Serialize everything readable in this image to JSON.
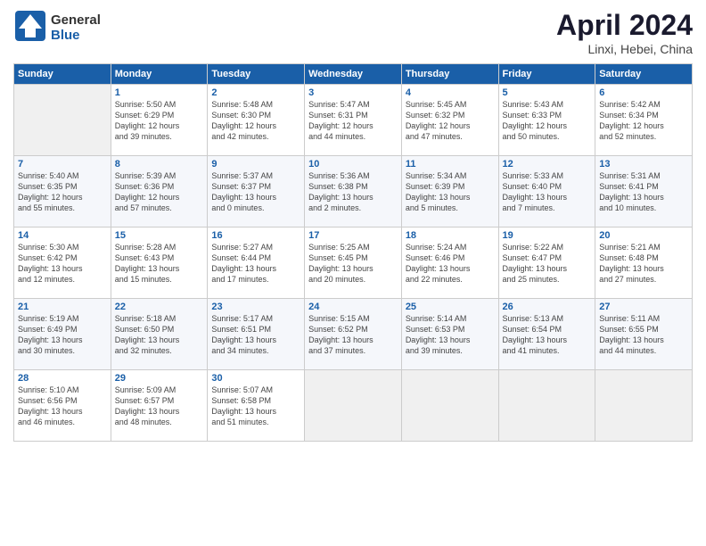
{
  "logo": {
    "general": "General",
    "blue": "Blue"
  },
  "title": "April 2024",
  "subtitle": "Linxi, Hebei, China",
  "days_header": [
    "Sunday",
    "Monday",
    "Tuesday",
    "Wednesday",
    "Thursday",
    "Friday",
    "Saturday"
  ],
  "weeks": [
    [
      {
        "num": "",
        "info": ""
      },
      {
        "num": "1",
        "info": "Sunrise: 5:50 AM\nSunset: 6:29 PM\nDaylight: 12 hours\nand 39 minutes."
      },
      {
        "num": "2",
        "info": "Sunrise: 5:48 AM\nSunset: 6:30 PM\nDaylight: 12 hours\nand 42 minutes."
      },
      {
        "num": "3",
        "info": "Sunrise: 5:47 AM\nSunset: 6:31 PM\nDaylight: 12 hours\nand 44 minutes."
      },
      {
        "num": "4",
        "info": "Sunrise: 5:45 AM\nSunset: 6:32 PM\nDaylight: 12 hours\nand 47 minutes."
      },
      {
        "num": "5",
        "info": "Sunrise: 5:43 AM\nSunset: 6:33 PM\nDaylight: 12 hours\nand 50 minutes."
      },
      {
        "num": "6",
        "info": "Sunrise: 5:42 AM\nSunset: 6:34 PM\nDaylight: 12 hours\nand 52 minutes."
      }
    ],
    [
      {
        "num": "7",
        "info": "Sunrise: 5:40 AM\nSunset: 6:35 PM\nDaylight: 12 hours\nand 55 minutes."
      },
      {
        "num": "8",
        "info": "Sunrise: 5:39 AM\nSunset: 6:36 PM\nDaylight: 12 hours\nand 57 minutes."
      },
      {
        "num": "9",
        "info": "Sunrise: 5:37 AM\nSunset: 6:37 PM\nDaylight: 13 hours\nand 0 minutes."
      },
      {
        "num": "10",
        "info": "Sunrise: 5:36 AM\nSunset: 6:38 PM\nDaylight: 13 hours\nand 2 minutes."
      },
      {
        "num": "11",
        "info": "Sunrise: 5:34 AM\nSunset: 6:39 PM\nDaylight: 13 hours\nand 5 minutes."
      },
      {
        "num": "12",
        "info": "Sunrise: 5:33 AM\nSunset: 6:40 PM\nDaylight: 13 hours\nand 7 minutes."
      },
      {
        "num": "13",
        "info": "Sunrise: 5:31 AM\nSunset: 6:41 PM\nDaylight: 13 hours\nand 10 minutes."
      }
    ],
    [
      {
        "num": "14",
        "info": "Sunrise: 5:30 AM\nSunset: 6:42 PM\nDaylight: 13 hours\nand 12 minutes."
      },
      {
        "num": "15",
        "info": "Sunrise: 5:28 AM\nSunset: 6:43 PM\nDaylight: 13 hours\nand 15 minutes."
      },
      {
        "num": "16",
        "info": "Sunrise: 5:27 AM\nSunset: 6:44 PM\nDaylight: 13 hours\nand 17 minutes."
      },
      {
        "num": "17",
        "info": "Sunrise: 5:25 AM\nSunset: 6:45 PM\nDaylight: 13 hours\nand 20 minutes."
      },
      {
        "num": "18",
        "info": "Sunrise: 5:24 AM\nSunset: 6:46 PM\nDaylight: 13 hours\nand 22 minutes."
      },
      {
        "num": "19",
        "info": "Sunrise: 5:22 AM\nSunset: 6:47 PM\nDaylight: 13 hours\nand 25 minutes."
      },
      {
        "num": "20",
        "info": "Sunrise: 5:21 AM\nSunset: 6:48 PM\nDaylight: 13 hours\nand 27 minutes."
      }
    ],
    [
      {
        "num": "21",
        "info": "Sunrise: 5:19 AM\nSunset: 6:49 PM\nDaylight: 13 hours\nand 30 minutes."
      },
      {
        "num": "22",
        "info": "Sunrise: 5:18 AM\nSunset: 6:50 PM\nDaylight: 13 hours\nand 32 minutes."
      },
      {
        "num": "23",
        "info": "Sunrise: 5:17 AM\nSunset: 6:51 PM\nDaylight: 13 hours\nand 34 minutes."
      },
      {
        "num": "24",
        "info": "Sunrise: 5:15 AM\nSunset: 6:52 PM\nDaylight: 13 hours\nand 37 minutes."
      },
      {
        "num": "25",
        "info": "Sunrise: 5:14 AM\nSunset: 6:53 PM\nDaylight: 13 hours\nand 39 minutes."
      },
      {
        "num": "26",
        "info": "Sunrise: 5:13 AM\nSunset: 6:54 PM\nDaylight: 13 hours\nand 41 minutes."
      },
      {
        "num": "27",
        "info": "Sunrise: 5:11 AM\nSunset: 6:55 PM\nDaylight: 13 hours\nand 44 minutes."
      }
    ],
    [
      {
        "num": "28",
        "info": "Sunrise: 5:10 AM\nSunset: 6:56 PM\nDaylight: 13 hours\nand 46 minutes."
      },
      {
        "num": "29",
        "info": "Sunrise: 5:09 AM\nSunset: 6:57 PM\nDaylight: 13 hours\nand 48 minutes."
      },
      {
        "num": "30",
        "info": "Sunrise: 5:07 AM\nSunset: 6:58 PM\nDaylight: 13 hours\nand 51 minutes."
      },
      {
        "num": "",
        "info": ""
      },
      {
        "num": "",
        "info": ""
      },
      {
        "num": "",
        "info": ""
      },
      {
        "num": "",
        "info": ""
      }
    ]
  ]
}
